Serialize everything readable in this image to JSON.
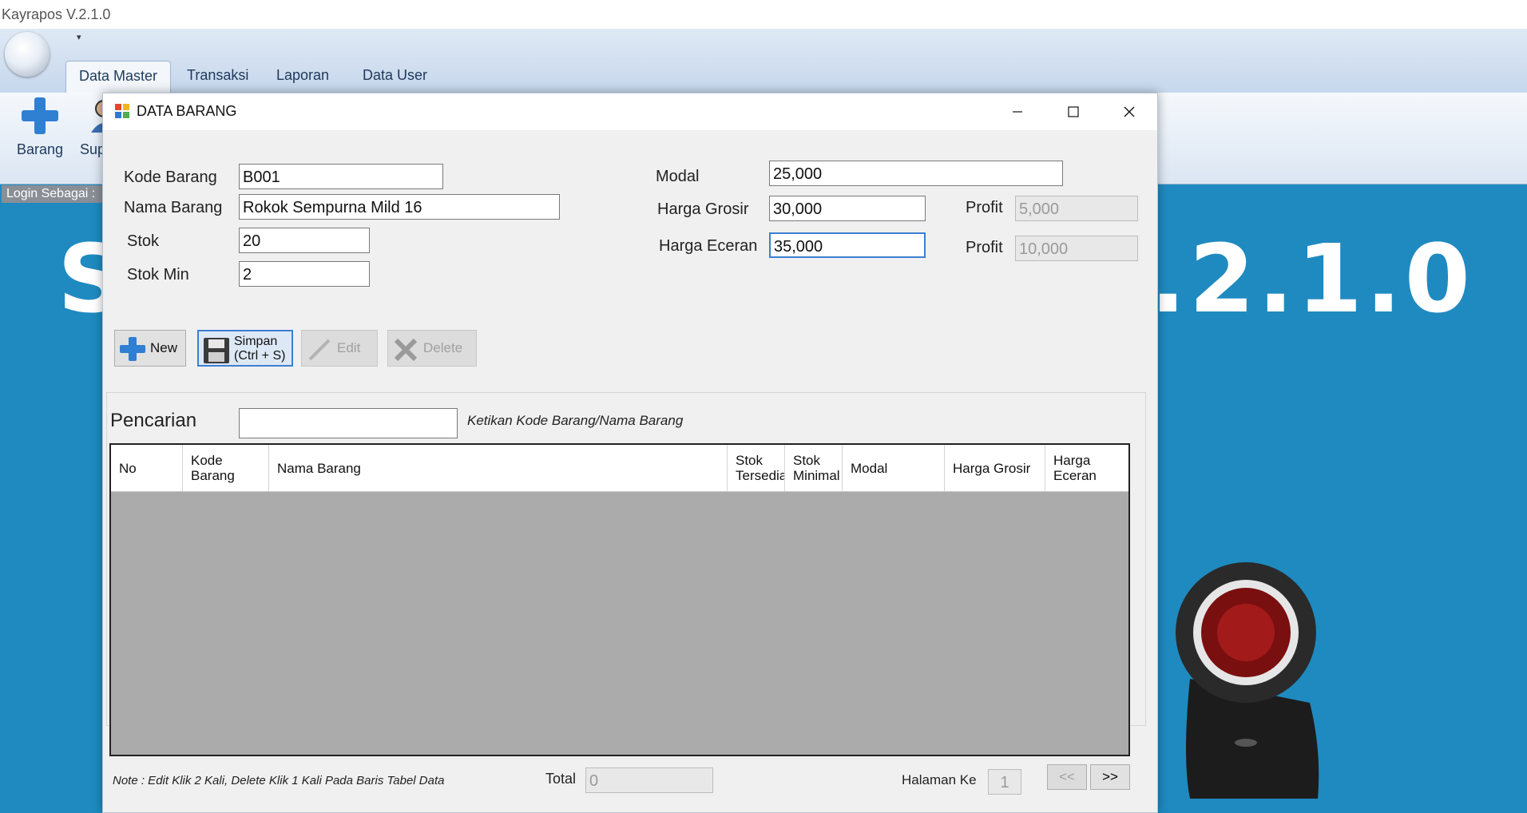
{
  "app": {
    "title": "Kayrapos V.2.1.0",
    "qat_arrow": "▾",
    "tabs": [
      {
        "label": "Data Master"
      },
      {
        "label": "Transaksi"
      },
      {
        "label": "Laporan"
      },
      {
        "label": "Data User"
      }
    ],
    "ribbon_buttons": [
      {
        "label": "Barang"
      },
      {
        "label": "Supplier"
      }
    ],
    "login_label": "Login Sebagai :",
    "bg_text_s": "S",
    "bg_text_version": ".2.1.0"
  },
  "dialog": {
    "title": "DATA BARANG",
    "fields": {
      "kode_barang": {
        "label": "Kode Barang",
        "value": "B001"
      },
      "nama_barang": {
        "label": "Nama Barang",
        "value": "Rokok Sempurna Mild 16"
      },
      "stok": {
        "label": "Stok",
        "value": "20"
      },
      "stok_min": {
        "label": "Stok Min",
        "value": "2"
      },
      "modal": {
        "label": "Modal",
        "value": "25,000"
      },
      "harga_grosir": {
        "label": "Harga Grosir",
        "value": "30,000"
      },
      "harga_eceran": {
        "label": "Harga Eceran",
        "value": "35,000"
      },
      "profit_grosir": {
        "label": "Profit",
        "value": "5,000"
      },
      "profit_eceran": {
        "label": "Profit",
        "value": "10,000"
      }
    },
    "buttons": {
      "new": "New",
      "simpan_line1": "Simpan",
      "simpan_line2": "(Ctrl + S)",
      "edit": "Edit",
      "delete": "Delete"
    },
    "search": {
      "label": "Pencarian",
      "value": "",
      "hint": "Ketikan Kode Barang/Nama Barang"
    },
    "table": {
      "columns": [
        {
          "line1": "No",
          "line2": ""
        },
        {
          "line1": "Kode",
          "line2": "Barang"
        },
        {
          "line1": "Nama Barang",
          "line2": ""
        },
        {
          "line1": "Stok",
          "line2": "Tersedia"
        },
        {
          "line1": "Stok",
          "line2": "Minimal"
        },
        {
          "line1": "Modal",
          "line2": ""
        },
        {
          "line1": "Harga Grosir",
          "line2": ""
        },
        {
          "line1": "Harga",
          "line2": "Eceran"
        }
      ],
      "rows": []
    },
    "footer": {
      "note": "Note : Edit Klik 2 Kali, Delete Klik 1 Kali Pada Baris Tabel Data",
      "total_label": "Total",
      "total_value": "0",
      "halaman_label": "Halaman Ke",
      "halaman_value": "1",
      "prev": "<<",
      "next": ">>"
    }
  }
}
